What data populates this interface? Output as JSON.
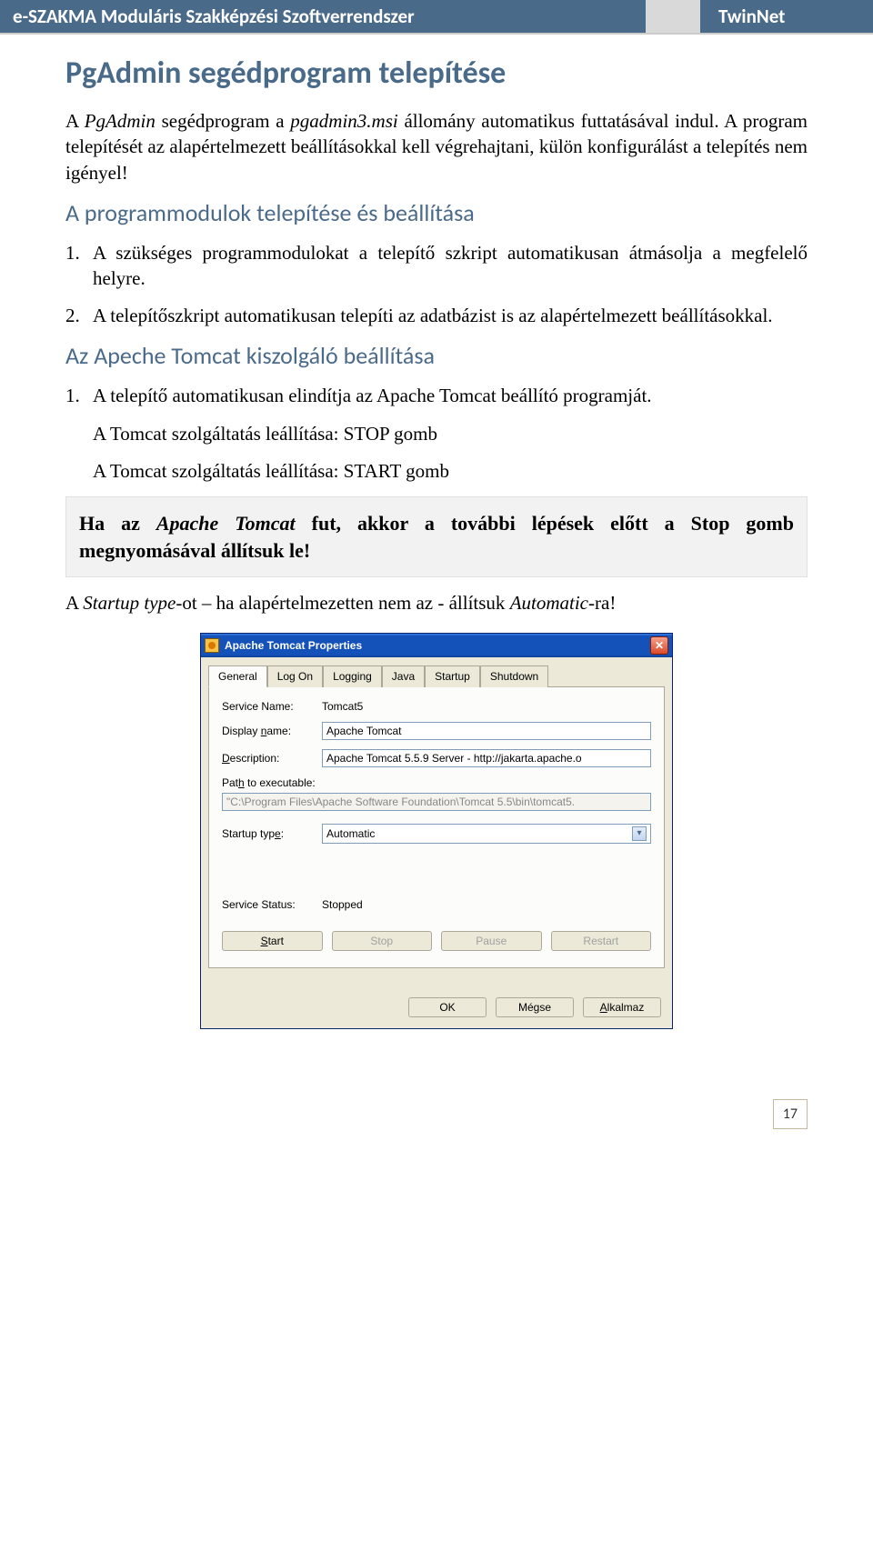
{
  "header": {
    "left": "e-SZAKMA Moduláris Szakképzési Szoftverrendszer",
    "right": "TwinNet"
  },
  "title": "PgAdmin segédprogram telepítése",
  "intro_pre": "A ",
  "intro_italic1": "PgAdmin",
  "intro_mid1": " segédprogram a ",
  "intro_italic2": "pgadmin3.msi",
  "intro_tail": " állomány automatikus futtatásával indul. A program telepítését az alapértelmezett beállításokkal kell végrehajtani, külön konfigurálást a telepítés nem igényel!",
  "section1": "A programmodulok telepítése és beállítása",
  "list1": {
    "i1": "A szükséges programmodulokat a telepítő szkript automatikusan átmásolja a megfelelő helyre.",
    "i2": "A telepítőszkript automatikusan telepíti az adatbázist is az alapértelmezett beállításokkal."
  },
  "section2": "Az Apeche Tomcat kiszolgáló beállítása",
  "list2": {
    "i1": "A telepítő automatikusan elindítja az Apache Tomcat beállító programját."
  },
  "sub1": "A Tomcat szolgáltatás leállítása: STOP gomb",
  "sub2": "A Tomcat szolgáltatás leállítása: START gomb",
  "callout_pre": "Ha az ",
  "callout_italic": "Apache Tomcat",
  "callout_tail": " fut, akkor a további lépések előtt a Stop gomb megnyomásával állítsuk le!",
  "after_pre": "A ",
  "after_italic1": "Startup type",
  "after_mid": "-ot – ha alapértelmezetten nem az - állítsuk ",
  "after_italic2": "Automatic",
  "after_tail": "-ra!",
  "dialog": {
    "title": "Apache Tomcat Properties",
    "tabs": {
      "general": "General",
      "logon": "Log On",
      "logging": "Logging",
      "java": "Java",
      "startup": "Startup",
      "shutdown": "Shutdown"
    },
    "labels": {
      "service_name": "Service Name:",
      "display_name_pre": "Display ",
      "display_name_ul": "n",
      "display_name_post": "ame:",
      "description_pre": "",
      "description_ul": "D",
      "description_post": "escription:",
      "path_pre": "Pat",
      "path_ul": "h",
      "path_post": " to executable:",
      "startup_type_pre": "Startup typ",
      "startup_type_ul": "e",
      "startup_type_post": ":",
      "service_status": "Service Status:"
    },
    "values": {
      "service_name": "Tomcat5",
      "display_name": "Apache Tomcat",
      "description": "Apache Tomcat 5.5.9 Server - http://jakarta.apache.o",
      "path": "\"C:\\Program Files\\Apache Software Foundation\\Tomcat 5.5\\bin\\tomcat5.",
      "startup_type": "Automatic",
      "service_status": "Stopped"
    },
    "buttons": {
      "start_ul": "S",
      "start_post": "tart",
      "stop": "Stop",
      "pause": "Pause",
      "restart": "Restart",
      "ok": "OK",
      "cancel": "Mégse",
      "apply_ul": "A",
      "apply_post": "lkalmaz"
    }
  },
  "page_number": "17"
}
